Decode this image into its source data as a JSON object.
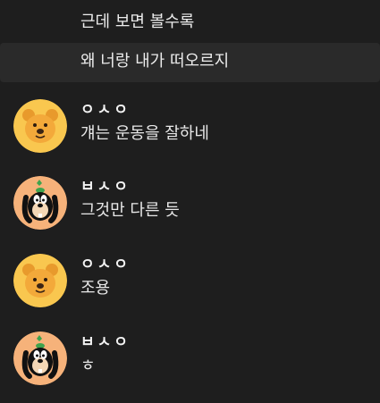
{
  "colors": {
    "background": "#1e1e1e",
    "hover_row": "#2a2a2a",
    "text": "#e8e8e8",
    "author": "#f2f2f2",
    "pooh_avatar_bg": "#f9c74f",
    "goofy_avatar_bg": "#f6b27a"
  },
  "messages": [
    {
      "type": "continuation",
      "text": "근데 보면 볼수록"
    },
    {
      "type": "continuation",
      "text": "왜 너랑 내가 떠오르지",
      "highlighted": true
    },
    {
      "type": "group",
      "author": "ㅇㅅㅇ",
      "avatar_icon": "pooh-bear-avatar-icon",
      "text": "걔는 운동을 잘하네"
    },
    {
      "type": "group",
      "author": "ㅂㅅㅇ",
      "avatar_icon": "goofy-avatar-icon",
      "text": "그것만 다른 듯"
    },
    {
      "type": "group",
      "author": "ㅇㅅㅇ",
      "avatar_icon": "pooh-bear-avatar-icon",
      "text": "조용"
    },
    {
      "type": "group",
      "author": "ㅂㅅㅇ",
      "avatar_icon": "goofy-avatar-icon",
      "text": "ㅎ"
    }
  ]
}
